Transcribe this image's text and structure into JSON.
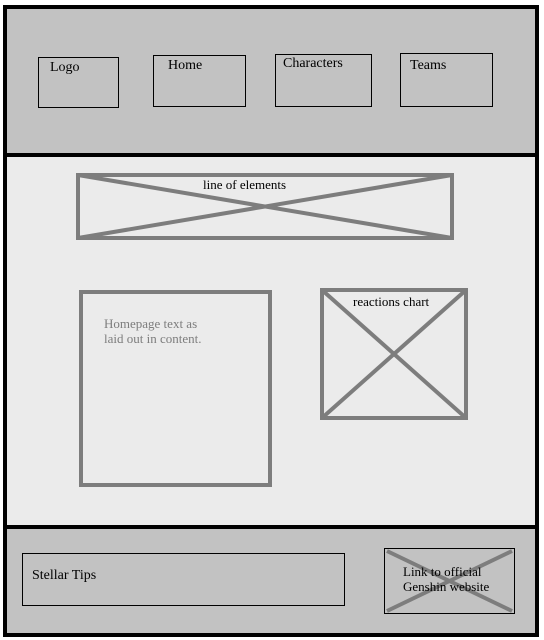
{
  "header": {
    "logo": "Logo",
    "nav": [
      "Home",
      "Characters",
      "Teams"
    ]
  },
  "main": {
    "banner_label": "line of elements",
    "homepage_text": "Homepage text as laid out in content.",
    "chart_label": "reactions chart"
  },
  "footer": {
    "tips_label": "Stellar Tips",
    "official_link": "Link to official Genshin website"
  },
  "colors": {
    "header_bg": "#c2c2c2",
    "main_bg": "#ebebeb",
    "placeholder_stroke": "#7d7d7d"
  }
}
